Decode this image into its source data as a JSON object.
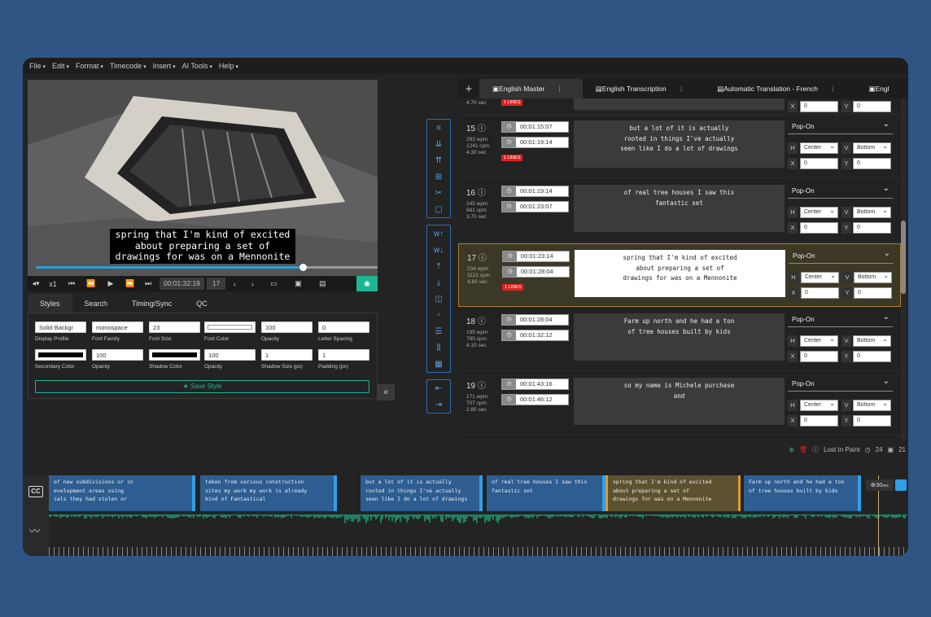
{
  "menu": [
    "File",
    "Edit",
    "Format",
    "Timecode",
    "Insert",
    "AI Tools",
    "Help"
  ],
  "player": {
    "caption_overlay": "spring that I'm kind of excited\nabout preparing a set of\ndrawings for was on a Mennonite",
    "progress": 0.78,
    "speed": "x1",
    "timecode": "00:01:32:19",
    "frame": "17"
  },
  "style_tabs": [
    "Styles",
    "Search",
    "Timing/Sync",
    "QC"
  ],
  "style_fields": {
    "display_profile": {
      "value": "Solid Backgr",
      "label": "Display Profile"
    },
    "font_family": {
      "value": "monospace",
      "label": "Font Family"
    },
    "font_size": {
      "value": "23",
      "label": "Font Size"
    },
    "font_color": {
      "label": "Font Color",
      "color": "#ffffff"
    },
    "opacity1": {
      "value": "100",
      "label": "Opacity"
    },
    "letter_spacing": {
      "value": "0",
      "label": "Letter Spacing"
    },
    "secondary_color": {
      "label": "Secondary Color",
      "color": "#000000"
    },
    "opacity2": {
      "value": "100",
      "label": "Opacity"
    },
    "shadow_color": {
      "label": "Shadow Color",
      "color": "#000000"
    },
    "opacity3": {
      "value": "100",
      "label": "Opacity"
    },
    "shadow_size": {
      "value": "1",
      "label": "Shadow Size (px)"
    },
    "padding": {
      "value": "1",
      "label": "Padding (px)"
    },
    "save_label": "Save Style"
  },
  "track_tabs": [
    "English Master",
    "English Transcription",
    "Automatic Translation - French",
    "Engl"
  ],
  "captions": [
    {
      "num": "15",
      "wpm": "293 wpm",
      "cpm": "1241 cpm",
      "dur": "4.30 sec",
      "badge": "1 LINES",
      "start": "00:01:15:07",
      "end": "00:01:19:14",
      "text": "but a lot of it is actually\nrooted in things I've actually\nseen like I do a lot of drawings",
      "mode": "Pop-On",
      "h": "Center",
      "v": "Bottom",
      "x": "0",
      "y": "0",
      "active": false
    },
    {
      "num": "16",
      "wpm": "145 wpm",
      "cpm": "681 cpm",
      "dur": "3.70 sec",
      "badge": "",
      "start": "00:01:19:14",
      "end": "00:01:23:07",
      "text": "of real tree houses I saw this\nfantastic set",
      "mode": "Pop-On",
      "h": "Center",
      "v": "Bottom",
      "x": "0",
      "y": "0",
      "active": false
    },
    {
      "num": "17",
      "wpm": "234 wpm",
      "cpm": "1121 cpm",
      "dur": "4.60 sec",
      "badge": "1 LINES",
      "start": "00:01:23:14",
      "end": "00:01:28:04",
      "text": "spring that I'm kind of excited\nabout preparing a set of\ndrawings for was on a Mennonite",
      "mode": "Pop-On",
      "h": "Center",
      "v": "Bottom",
      "x": "0",
      "y": "0",
      "active": true
    },
    {
      "num": "18",
      "wpm": "195 wpm",
      "cpm": "795 cpm",
      "dur": "4.10 sec",
      "badge": "",
      "start": "00:01:28:04",
      "end": "00:01:32:12",
      "text": "Farm up north and he had a ton\nof tree houses built by kids",
      "mode": "Pop-On",
      "h": "Center",
      "v": "Bottom",
      "x": "0",
      "y": "0",
      "active": false
    },
    {
      "num": "19",
      "wpm": "171 wpm",
      "cpm": "707 cpm",
      "dur": "2.80 sec",
      "badge": "",
      "start": "00:01:43:16",
      "end": "00:01:46:12",
      "text": "so my name is Michele purchase\nand",
      "mode": "Pop-On",
      "h": "Center",
      "v": "Bottom",
      "x": "0",
      "y": "0",
      "active": false
    }
  ],
  "top_partial": {
    "dur": "4.70 sec",
    "badge": "1 LINES",
    "x": "0",
    "y": "0"
  },
  "status": {
    "label": "Lost In Paint",
    "count1": "24",
    "count2": "21"
  },
  "timeline": {
    "blocks": [
      {
        "text": "of new subdivisions or in\nevelopment areas using\nials they had stolen or",
        "active": false
      },
      {
        "text": "taken from various construction\nsites my work my work is already\nkind of Fantastical",
        "active": false
      },
      {
        "text": "but a lot of it is actually\nrooted in things I've actually\nseen like I do a lot of drawings",
        "active": false
      },
      {
        "text": "of real tree houses I saw this\nfantastic set",
        "active": false
      },
      {
        "text": "spring that I'm kind of excited\nabout preparing a set of\ndrawings for was on a Mennonite",
        "active": true
      },
      {
        "text": "Farm up north and he had a ton\nof tree houses built by kids",
        "active": false
      }
    ],
    "zoom": "30",
    "zoom_unit": "sec"
  },
  "colors": {
    "accent": "#1ab792",
    "blue": "#2fa0e8",
    "badge": "#dd2222",
    "active_border": "#a6852a",
    "waveform": "#1f9e78"
  }
}
